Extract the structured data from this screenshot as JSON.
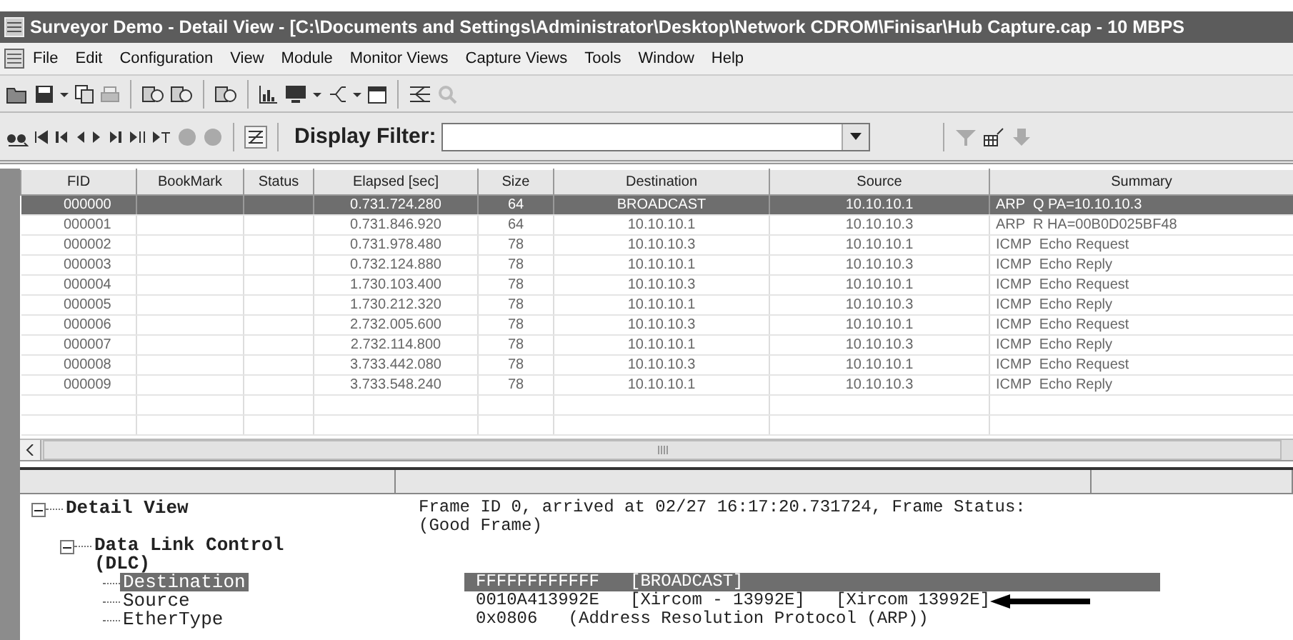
{
  "window": {
    "title": "Surveyor Demo - Detail View - [C:\\Documents and Settings\\Administrator\\Desktop\\Network CDROM\\Finisar\\Hub Capture.cap - 10 MBPS"
  },
  "menu": [
    "File",
    "Edit",
    "Configuration",
    "View",
    "Module",
    "Monitor Views",
    "Capture Views",
    "Tools",
    "Window",
    "Help"
  ],
  "display_filter": {
    "label": "Display Filter:"
  },
  "table": {
    "columns": [
      "FID",
      "BookMark",
      "Status",
      "Elapsed [sec]",
      "Size",
      "Destination",
      "Source",
      "Summary"
    ],
    "rows": [
      {
        "cells": [
          "000000",
          "",
          "",
          "0.731.724.280",
          "64",
          "BROADCAST",
          "10.10.10.1",
          "ARP  Q PA=10.10.10.3"
        ],
        "selected": true
      },
      {
        "cells": [
          "000001",
          "",
          "",
          "0.731.846.920",
          "64",
          "10.10.10.1",
          "10.10.10.3",
          "ARP  R HA=00B0D025BF48"
        ],
        "selected": false
      },
      {
        "cells": [
          "000002",
          "",
          "",
          "0.731.978.480",
          "78",
          "10.10.10.3",
          "10.10.10.1",
          "ICMP  Echo Request"
        ],
        "selected": false
      },
      {
        "cells": [
          "000003",
          "",
          "",
          "0.732.124.880",
          "78",
          "10.10.10.1",
          "10.10.10.3",
          "ICMP  Echo Reply"
        ],
        "selected": false
      },
      {
        "cells": [
          "000004",
          "",
          "",
          "1.730.103.400",
          "78",
          "10.10.10.3",
          "10.10.10.1",
          "ICMP  Echo Request"
        ],
        "selected": false
      },
      {
        "cells": [
          "000005",
          "",
          "",
          "1.730.212.320",
          "78",
          "10.10.10.1",
          "10.10.10.3",
          "ICMP  Echo Reply"
        ],
        "selected": false
      },
      {
        "cells": [
          "000006",
          "",
          "",
          "2.732.005.600",
          "78",
          "10.10.10.3",
          "10.10.10.1",
          "ICMP  Echo Request"
        ],
        "selected": false
      },
      {
        "cells": [
          "000007",
          "",
          "",
          "2.732.114.800",
          "78",
          "10.10.10.1",
          "10.10.10.3",
          "ICMP  Echo Reply"
        ],
        "selected": false
      },
      {
        "cells": [
          "000008",
          "",
          "",
          "3.733.442.080",
          "78",
          "10.10.10.3",
          "10.10.10.1",
          "ICMP  Echo Request"
        ],
        "selected": false
      },
      {
        "cells": [
          "000009",
          "",
          "",
          "3.733.548.240",
          "78",
          "10.10.10.1",
          "10.10.10.3",
          "ICMP  Echo Reply"
        ],
        "selected": false
      }
    ]
  },
  "detail_tree": [
    {
      "label": "Detail View",
      "expanded": true,
      "selected": false,
      "value": "Frame ID 0, arrived at 02/27 16:17:20.731724, Frame Status: (Good Frame)",
      "children": [
        {
          "label": "Data Link Control (DLC)",
          "expanded": true,
          "selected": false,
          "children": [
            {
              "label": "Destination",
              "selected": true,
              "value": "FFFFFFFFFFFF   [BROADCAST]"
            },
            {
              "label": "Source",
              "selected": false,
              "value": "0010A413992E   [Xircom - 13992E]   [Xircom 13992E]",
              "annotated": true
            },
            {
              "label": "EtherType",
              "selected": false,
              "value": "0x0806   (Address Resolution Protocol (ARP))"
            }
          ]
        }
      ]
    }
  ]
}
